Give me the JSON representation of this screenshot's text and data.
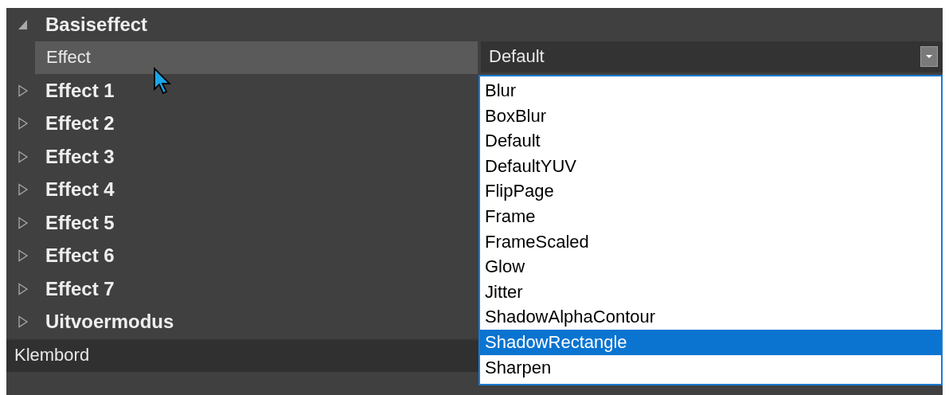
{
  "groups": [
    {
      "label": "Basiseffect",
      "expanded": true,
      "properties": [
        {
          "name": "Effect",
          "value": "Default",
          "selected": true
        }
      ]
    },
    {
      "label": "Effect 1",
      "expanded": false
    },
    {
      "label": "Effect 2",
      "expanded": false
    },
    {
      "label": "Effect 3",
      "expanded": false
    },
    {
      "label": "Effect 4",
      "expanded": false
    },
    {
      "label": "Effect 5",
      "expanded": false
    },
    {
      "label": "Effect 6",
      "expanded": false
    },
    {
      "label": "Effect 7",
      "expanded": false
    },
    {
      "label": "Uitvoermodus",
      "expanded": false
    }
  ],
  "description": {
    "text": "Klembord"
  },
  "dropdown": {
    "open": true,
    "options": [
      {
        "label": "Blur",
        "selected": false
      },
      {
        "label": "BoxBlur",
        "selected": false
      },
      {
        "label": "Default",
        "selected": false
      },
      {
        "label": "DefaultYUV",
        "selected": false
      },
      {
        "label": "FlipPage",
        "selected": false
      },
      {
        "label": "Frame",
        "selected": false
      },
      {
        "label": "FrameScaled",
        "selected": false
      },
      {
        "label": "Glow",
        "selected": false
      },
      {
        "label": "Jitter",
        "selected": false
      },
      {
        "label": "ShadowAlphaContour",
        "selected": false
      },
      {
        "label": "ShadowRectangle",
        "selected": true
      },
      {
        "label": "Sharpen",
        "selected": false
      }
    ]
  }
}
